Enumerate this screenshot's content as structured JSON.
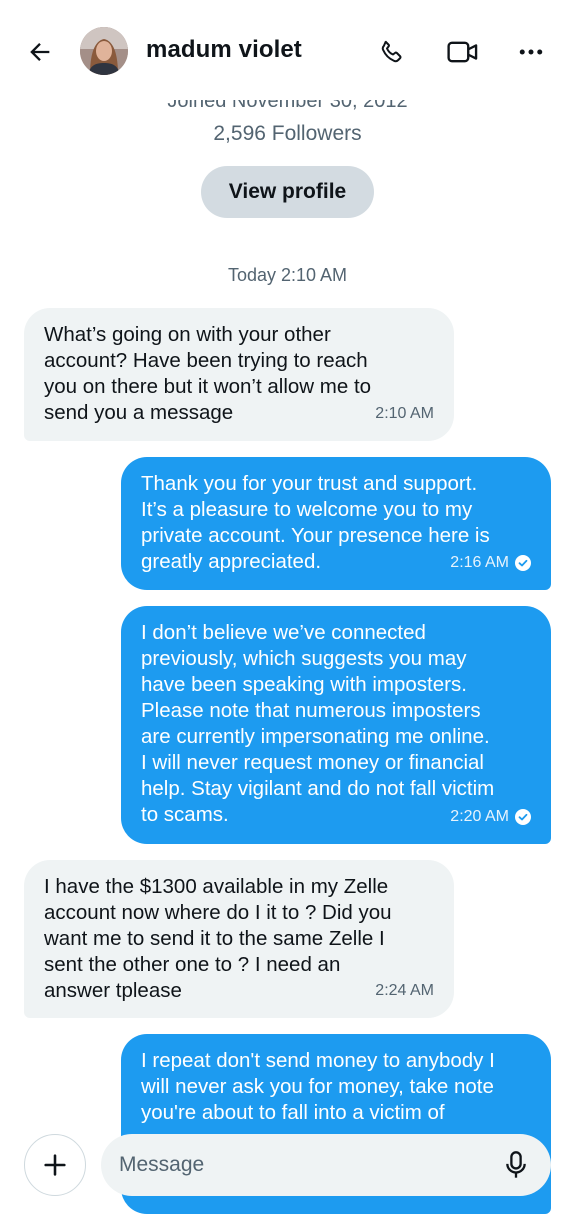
{
  "header": {
    "name": "madum violet",
    "icons": [
      "back-arrow-icon",
      "phone-icon",
      "video-camera-icon",
      "more-dots-icon"
    ]
  },
  "profile": {
    "joined": "Joined November 30, 2012",
    "followers": "2,596 Followers",
    "view_profile_label": "View profile"
  },
  "date_separator": "Today 2:10 AM",
  "messages": [
    {
      "direction": "incoming",
      "text": "What’s going on with your other\naccount? Have been trying to reach\nyou on there but it won’t allow me to\nsend you a message",
      "time": "2:10 AM"
    },
    {
      "direction": "outgoing",
      "text": "Thank you for your trust and support.\nIt’s a pleasure to welcome you to my\nprivate account. Your presence here is\ngreatly appreciated.",
      "time": "2:16 AM",
      "seen": true
    },
    {
      "direction": "outgoing",
      "text": "I don’t believe we’ve connected\npreviously, which suggests you may\nhave been speaking with imposters.\nPlease note that numerous imposters\nare currently impersonating me online.\nI will never request money or financial\nhelp. Stay vigilant and do not fall victim\nto scams.",
      "time": "2:20 AM",
      "seen": true
    },
    {
      "direction": "incoming",
      "text": "I have the $1300 available in my Zelle\naccount now where do I  it to ? Did you\nwant me to send it to the same Zelle I\nsent the other one to ? I need an\nanswer tplease",
      "time": "2:24 AM"
    },
    {
      "direction": "outgoing",
      "text": "I repeat don't send money to anybody I\nwill never ask you for money, take note\nyou're about to fall into a victim of",
      "time": ""
    }
  ],
  "composer": {
    "placeholder": "Message"
  },
  "colors": {
    "outgoing_bubble": "#1d9bf0",
    "incoming_bubble": "#eff3f4",
    "secondary_text": "#536471"
  }
}
